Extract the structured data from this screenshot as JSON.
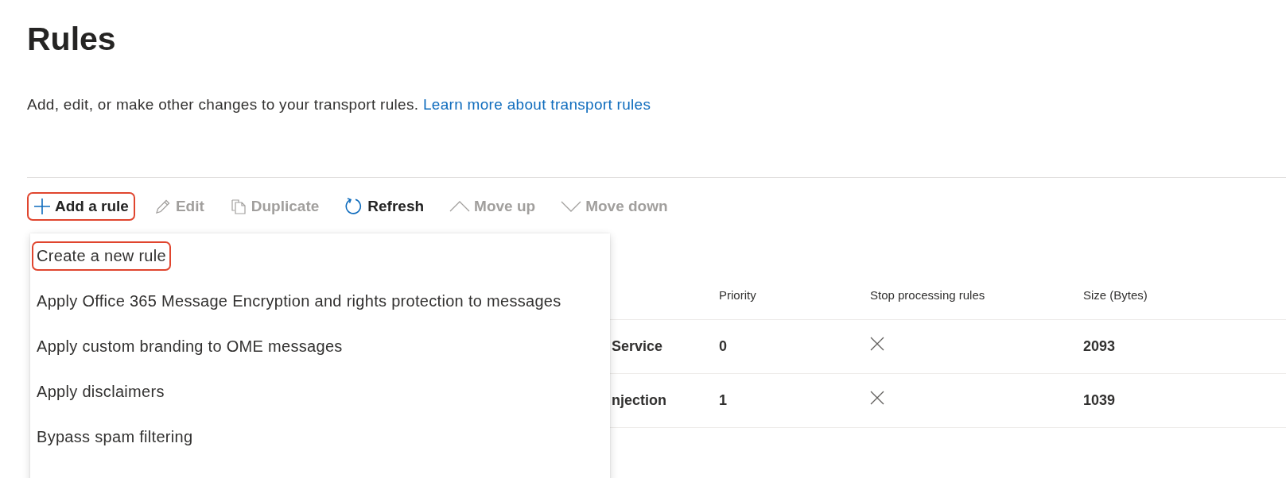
{
  "page": {
    "title": "Rules",
    "description": "Add, edit, or make other changes to your transport rules.",
    "link": "Learn more about transport rules"
  },
  "toolbar": [
    {
      "kind": "add",
      "label": "Add a rule",
      "disabled": false,
      "highlighted": true
    },
    {
      "kind": "edit",
      "label": "Edit",
      "disabled": true,
      "highlighted": false
    },
    {
      "kind": "duplicate",
      "label": "Duplicate",
      "disabled": true,
      "highlighted": false
    },
    {
      "kind": "refresh",
      "label": "Refresh",
      "disabled": false,
      "highlighted": false
    },
    {
      "kind": "up",
      "label": "Move up",
      "disabled": true,
      "highlighted": false
    },
    {
      "kind": "down",
      "label": "Move down",
      "disabled": true,
      "highlighted": false
    }
  ],
  "menu": [
    {
      "label": "Create a new rule",
      "highlighted": true
    },
    {
      "label": "Apply Office 365 Message Encryption and rights protection to messages",
      "highlighted": false
    },
    {
      "label": "Apply custom branding to OME messages",
      "highlighted": false
    },
    {
      "label": "Apply disclaimers",
      "highlighted": false
    },
    {
      "label": "Bypass spam filtering",
      "highlighted": false
    }
  ],
  "table": {
    "columns": [
      "Priority",
      "Stop processing rules",
      "Size (Bytes)"
    ],
    "rows": [
      {
        "column_1": "Service",
        "priority": "0",
        "stop_processing": false,
        "size": "2093"
      },
      {
        "column_1": "njection",
        "priority": "1",
        "stop_processing": false,
        "size": "1039"
      }
    ]
  }
}
